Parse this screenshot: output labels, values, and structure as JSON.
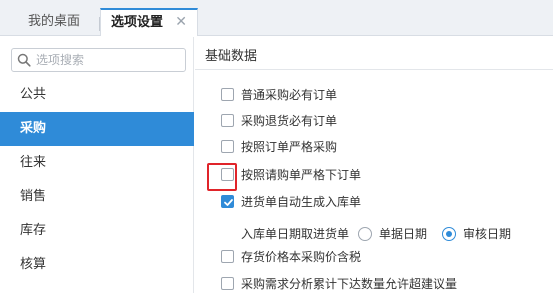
{
  "tabs": {
    "desk_label": "我的桌面",
    "options_label": "选项设置",
    "close_glyph": "✕"
  },
  "search": {
    "placeholder": "选项搜索"
  },
  "sidebar": {
    "items": [
      {
        "label": "公共",
        "active": false
      },
      {
        "label": "采购",
        "active": true
      },
      {
        "label": "往来",
        "active": false
      },
      {
        "label": "销售",
        "active": false
      },
      {
        "label": "库存",
        "active": false
      },
      {
        "label": "核算",
        "active": false
      }
    ]
  },
  "main": {
    "section_title": "基础数据",
    "options": [
      {
        "label": "普通采购必有订单",
        "checked": false
      },
      {
        "label": "采购退货必有订单",
        "checked": false
      },
      {
        "label": "按照订单严格采购",
        "checked": false
      },
      {
        "label": "按照请购单严格下订单",
        "checked": false
      },
      {
        "label": "进货单自动生成入库单",
        "checked": true
      },
      {
        "label": "存货价格本采购价含税",
        "checked": false
      },
      {
        "label": "采购需求分析累计下达数量允许超建议量",
        "checked": false
      }
    ],
    "inbound_date": {
      "label": "入库单日期取进货单",
      "options": [
        {
          "label": "单据日期",
          "selected": false
        },
        {
          "label": "审核日期",
          "selected": true
        }
      ]
    }
  },
  "colors": {
    "accent": "#2f8bd8",
    "highlight": "#e0242a"
  }
}
